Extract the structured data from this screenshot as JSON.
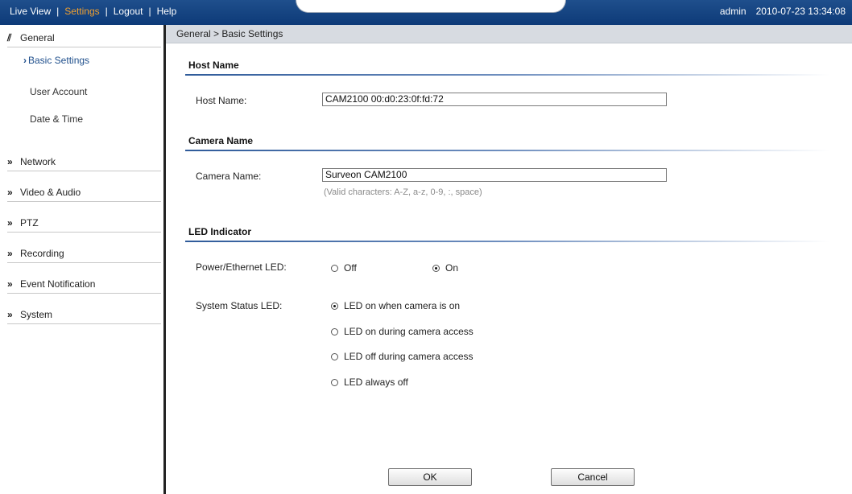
{
  "topbar": {
    "nav": [
      "Live View",
      "Settings",
      "Logout",
      "Help"
    ],
    "user": "admin",
    "datetime": "2010-07-23 13:34:08"
  },
  "sidebar": {
    "general": "General",
    "general_items": [
      "Basic Settings",
      "User Account",
      "Date & Time"
    ],
    "sections": [
      "Network",
      "Video & Audio",
      "PTZ",
      "Recording",
      "Event Notification",
      "System"
    ]
  },
  "breadcrumb": "General > Basic Settings",
  "host": {
    "title": "Host Name",
    "label": "Host Name:",
    "value": "CAM2100 00:d0:23:0f:fd:72"
  },
  "camera": {
    "title": "Camera Name",
    "label": "Camera Name:",
    "value": "Surveon CAM2100",
    "hint": "(Valid characters: A-Z, a-z, 0-9, :, space)"
  },
  "led": {
    "title": "LED Indicator",
    "power_label": "Power/Ethernet LED:",
    "power_options": [
      "Off",
      "On"
    ],
    "power_selected": "On",
    "status_label": "System Status LED:",
    "status_options": [
      "LED on when camera is on",
      "LED on during camera access",
      "LED off during camera access",
      "LED always off"
    ],
    "status_selected": "LED on when camera is on"
  },
  "buttons": {
    "ok": "OK",
    "cancel": "Cancel"
  }
}
